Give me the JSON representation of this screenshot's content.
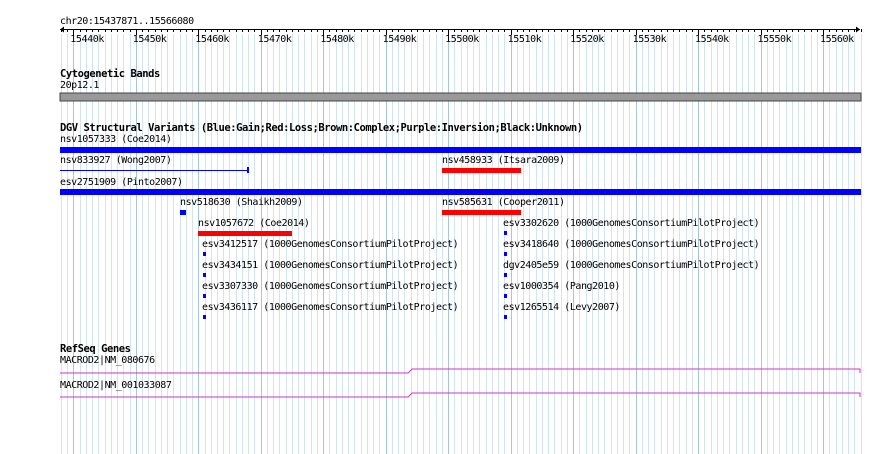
{
  "ruler": {
    "title": "chr20:15437871..15566080",
    "start": 15437871,
    "end": 15566080,
    "tick_labels": [
      "15440k",
      "15450k",
      "15460k",
      "15470k",
      "15480k",
      "15490k",
      "15500k",
      "15510k",
      "15520k",
      "15530k",
      "15540k",
      "15550k",
      "15560k"
    ],
    "tick_positions": [
      15440000,
      15450000,
      15460000,
      15470000,
      15480000,
      15490000,
      15500000,
      15510000,
      15520000,
      15530000,
      15540000,
      15550000,
      15560000
    ]
  },
  "cytoband": {
    "title": "Cytogenetic Bands",
    "band_label": "20p12.1",
    "color": "#999999"
  },
  "dgv": {
    "title": "DGV Structural Variants (Blue:Gain;Red:Loss;Brown:Complex;Purple:Inversion;Black:Unknown)",
    "colors": {
      "gain": "#0000ff",
      "loss": "#ff0000"
    },
    "features": [
      {
        "id": "f1",
        "label": "nsv1057333 (Coe2014)",
        "type": "gain",
        "style": "bar",
        "start": 15437871,
        "end": 15566080
      },
      {
        "id": "f2",
        "label": "nsv833927 (Wong2007)",
        "type": "gain",
        "style": "line",
        "start": 15437871,
        "end": 15468000
      },
      {
        "id": "f3",
        "label": "nsv458933 (Itsara2009)",
        "type": "loss",
        "style": "bar",
        "start": 15499000,
        "end": 15511700
      },
      {
        "id": "f4",
        "label": "esv2751909 (Pinto2007)",
        "type": "gain",
        "style": "bar",
        "start": 15437871,
        "end": 15566080
      },
      {
        "id": "f5",
        "label": "nsv518630 (Shaikh2009)",
        "type": "gain",
        "style": "bar",
        "start": 15457000,
        "end": 15458000
      },
      {
        "id": "f6",
        "label": "nsv585631 (Cooper2011)",
        "type": "loss",
        "style": "bar",
        "start": 15499000,
        "end": 15511700
      },
      {
        "id": "f7",
        "label": "nsv1057672 (Coe2014)",
        "type": "loss",
        "style": "bar",
        "start": 15460000,
        "end": 15475000
      },
      {
        "id": "f8",
        "label": "esv3302620 (1000GenomesConsortiumPilotProject)",
        "type": "gain",
        "style": "tick",
        "start": 15509000,
        "end": 15509400
      },
      {
        "id": "f9",
        "label": "esv3412517 (1000GenomesConsortiumPilotProject)",
        "type": "gain",
        "style": "tick",
        "start": 15460800,
        "end": 15461200
      },
      {
        "id": "f10",
        "label": "esv3418640 (1000GenomesConsortiumPilotProject)",
        "type": "gain",
        "style": "tick",
        "start": 15509000,
        "end": 15509400
      },
      {
        "id": "f11",
        "label": "esv3434151 (1000GenomesConsortiumPilotProject)",
        "type": "gain",
        "style": "tick",
        "start": 15460800,
        "end": 15461200
      },
      {
        "id": "f12",
        "label": "dgv2405e59 (1000GenomesConsortiumPilotProject)",
        "type": "gain",
        "style": "tick",
        "start": 15509000,
        "end": 15509400
      },
      {
        "id": "f13",
        "label": "esv3307330 (1000GenomesConsortiumPilotProject)",
        "type": "gain",
        "style": "tick",
        "start": 15460800,
        "end": 15461200
      },
      {
        "id": "f14",
        "label": "esv1000354 (Pang2010)",
        "type": "gain",
        "style": "tick",
        "start": 15509000,
        "end": 15509400
      },
      {
        "id": "f15",
        "label": "esv3436117 (1000GenomesConsortiumPilotProject)",
        "type": "gain",
        "style": "tick",
        "start": 15460800,
        "end": 15461200
      },
      {
        "id": "f16",
        "label": "esv1265514 (Levy2007)",
        "type": "gain",
        "style": "tick",
        "start": 15509000,
        "end": 15509400
      }
    ]
  },
  "refseq": {
    "title": "RefSeq Genes",
    "color": "#cc33cc",
    "genes": [
      {
        "id": "g1",
        "label": "MACROD2|NM_080676"
      },
      {
        "id": "g2",
        "label": "MACROD2|NM_001033087"
      }
    ]
  }
}
